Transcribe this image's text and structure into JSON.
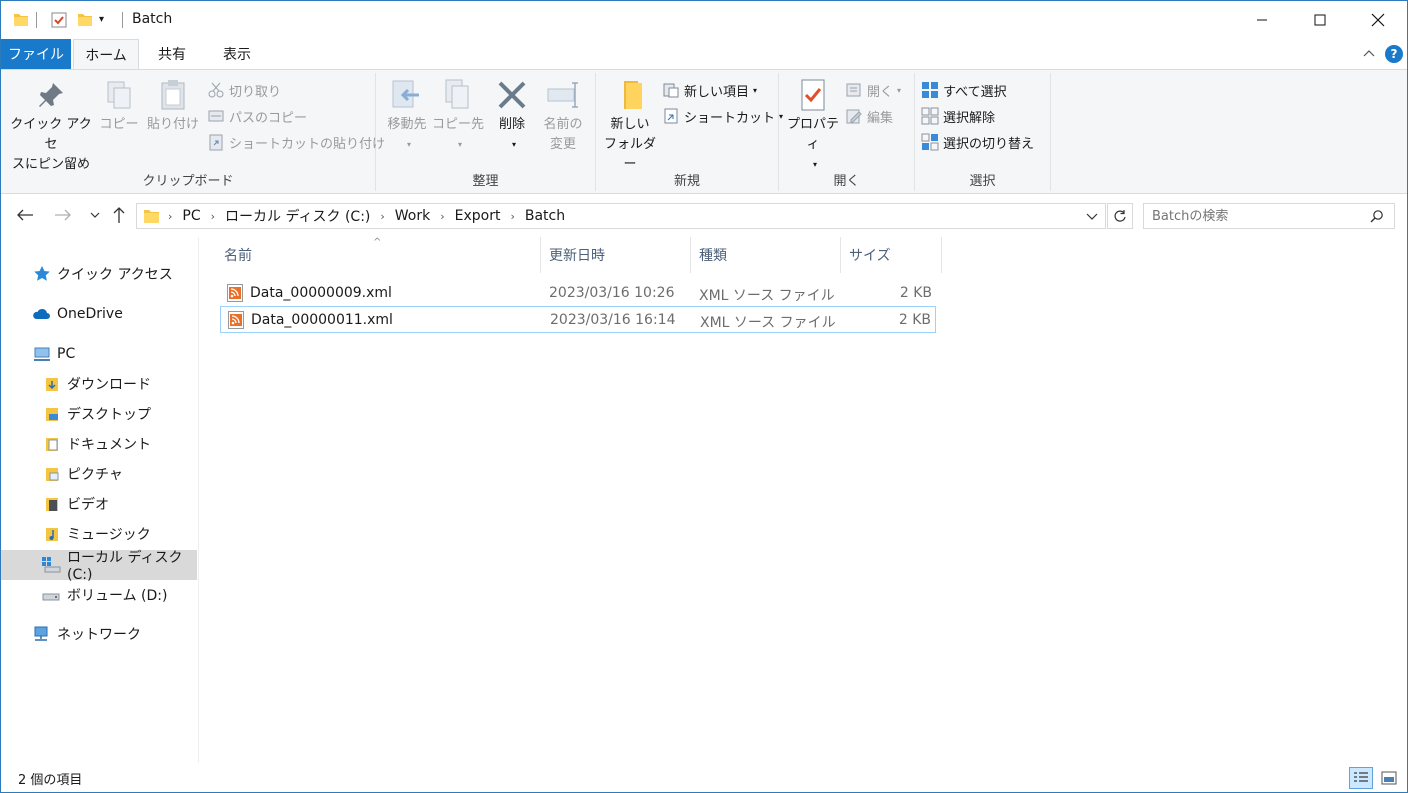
{
  "window": {
    "title": "Batch",
    "minimize_icon": "minimize-icon",
    "maximize_icon": "maximize-icon",
    "close_icon": "close-icon"
  },
  "ribbon_tabs": [
    {
      "label": "ファイル"
    },
    {
      "label": "ホーム"
    },
    {
      "label": "共有"
    },
    {
      "label": "表示"
    }
  ],
  "ribbon": {
    "clipboard": {
      "label": "クリップボード",
      "pin_line1": "クイック アクセ",
      "pin_line2": "スにピン留め",
      "copy": "コピー",
      "paste": "貼り付け",
      "cut": "切り取り",
      "copy_path": "パスのコピー",
      "paste_shortcut": "ショートカットの貼り付け"
    },
    "organize": {
      "label": "整理",
      "move_to": "移動先",
      "copy_to": "コピー先",
      "delete": "削除",
      "rename_line1": "名前の",
      "rename_line2": "変更"
    },
    "new": {
      "label": "新規",
      "new_folder_line1": "新しい",
      "new_folder_line2": "フォルダー",
      "new_item": "新しい項目",
      "shortcut": "ショートカット"
    },
    "open": {
      "label": "開く",
      "properties": "プロパティ",
      "open": "開く",
      "edit": "編集"
    },
    "select": {
      "label": "選択",
      "select_all": "すべて選択",
      "select_none": "選択解除",
      "invert": "選択の切り替え"
    }
  },
  "address": {
    "crumbs": [
      "PC",
      "ローカル ディスク (C:)",
      "Work",
      "Export",
      "Batch"
    ],
    "search_placeholder": "Batchの検索"
  },
  "nav_pane": {
    "quick_access": "クイック アクセス",
    "onedrive": "OneDrive",
    "pc": "PC",
    "downloads": "ダウンロード",
    "desktop": "デスクトップ",
    "documents": "ドキュメント",
    "pictures": "ピクチャ",
    "videos": "ビデオ",
    "music": "ミュージック",
    "local_disk": "ローカル ディスク (C:)",
    "volume_d": "ボリューム (D:)",
    "network": "ネットワーク"
  },
  "columns": {
    "name": "名前",
    "date": "更新日時",
    "type": "種類",
    "size": "サイズ"
  },
  "files": [
    {
      "name": "Data_00000009.xml",
      "date": "2023/03/16 10:26",
      "type": "XML ソース ファイル",
      "size": "2 KB"
    },
    {
      "name": "Data_00000011.xml",
      "date": "2023/03/16 16:14",
      "type": "XML ソース ファイル",
      "size": "2 KB"
    }
  ],
  "status": {
    "item_count": "2 個の項目"
  },
  "colors": {
    "accent": "#1979ca",
    "selection": "#cce8ff",
    "focus_border": "#99d1ff"
  }
}
